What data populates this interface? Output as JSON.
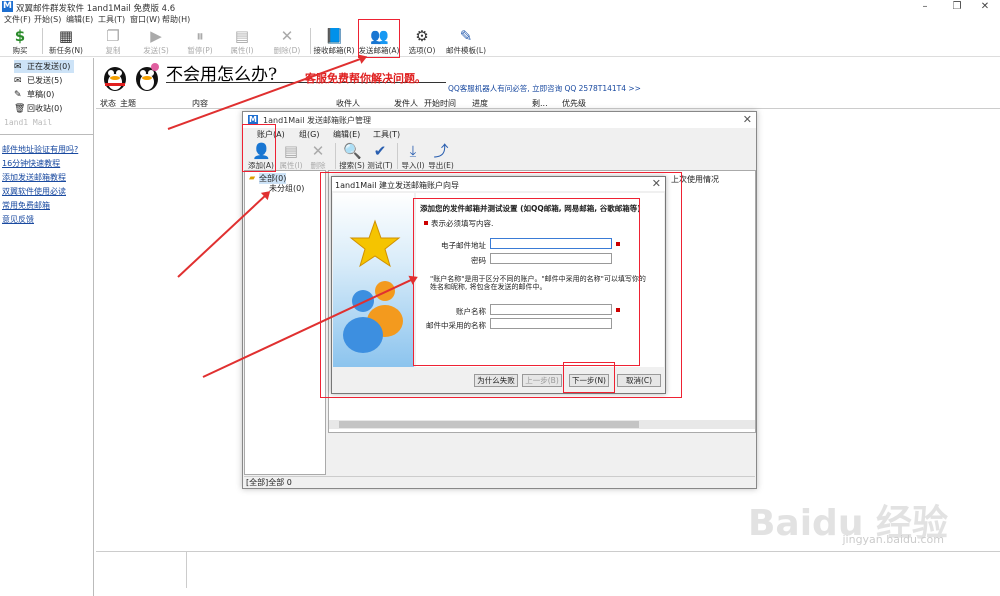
{
  "window": {
    "title": "双翼邮件群发软件 1and1Mail 免费版 4.6",
    "logo_text": "M",
    "controls": {
      "minimize": "–",
      "maximize": "❐",
      "close": "✕"
    }
  },
  "menu": [
    "文件(F)",
    "开始(S)",
    "编辑(E)",
    "工具(T)",
    "窗口(W)",
    "帮助(H)"
  ],
  "toolbar": [
    {
      "label": "购买",
      "icon": "dollar-icon",
      "glyph": "$",
      "enabled": true
    },
    {
      "label": "新任务(N)",
      "icon": "new-task-icon",
      "glyph": "▦",
      "enabled": true
    },
    {
      "label": "复制",
      "icon": "copy-icon",
      "glyph": "❐",
      "enabled": false
    },
    {
      "label": "发送(S)",
      "icon": "send-icon",
      "glyph": "▶",
      "enabled": false
    },
    {
      "label": "暂停(P)",
      "icon": "pause-icon",
      "glyph": "⏸",
      "enabled": false
    },
    {
      "label": "属性(I)",
      "icon": "properties-icon",
      "glyph": "▤",
      "enabled": false
    },
    {
      "label": "删除(D)",
      "icon": "delete-icon",
      "glyph": "✕",
      "enabled": false
    },
    {
      "label": "接收邮箱(R)",
      "icon": "receive-mailbox-icon",
      "glyph": "📘",
      "enabled": true
    },
    {
      "label": "发送邮箱(A)",
      "icon": "send-mailbox-icon",
      "glyph": "👥",
      "enabled": true
    },
    {
      "label": "选项(O)",
      "icon": "options-icon",
      "glyph": "⚙",
      "enabled": true
    },
    {
      "label": "邮件模板(L)",
      "icon": "template-icon",
      "glyph": "✎",
      "enabled": true
    }
  ],
  "folders": [
    {
      "label": "正在发送(0)",
      "icon": "sending-icon",
      "glyph": "✉",
      "selected": true
    },
    {
      "label": "已发送(5)",
      "icon": "sent-icon",
      "glyph": "✉",
      "selected": false
    },
    {
      "label": "草稿(0)",
      "icon": "drafts-icon",
      "glyph": "✎",
      "selected": false
    },
    {
      "label": "回收站(0)",
      "icon": "trash-icon",
      "glyph": "🗑",
      "selected": false
    }
  ],
  "sidebar_brand": "1and1 Mail",
  "links": [
    "邮件地址验证有用吗?",
    "16分钟快速教程",
    "添加发送邮箱教程",
    "双翼软件使用必读",
    "常用免费邮箱",
    "意见反馈"
  ],
  "banner": {
    "heading": "不会用怎么办?",
    "subheading": "客服免费帮你解决问题。",
    "qq_line": "QQ客服机器人有问必答, 立即咨询 QQ 2578T141T4 >>"
  },
  "columns": [
    "状态",
    "主题",
    "内容",
    "收件人",
    "发件人",
    "开始时间",
    "进度",
    "剩...",
    "优先级"
  ],
  "account_dialog": {
    "title": "1and1Mail 发送邮箱账户管理",
    "close": "✕",
    "menu": [
      "账户(A)",
      "组(G)",
      "编辑(E)",
      "工具(T)"
    ],
    "toolbar": [
      {
        "label": "添加(A)",
        "icon": "add-account-icon",
        "glyph": "👤",
        "enabled": true
      },
      {
        "label": "属性(I)",
        "icon": "properties-icon",
        "glyph": "▤",
        "enabled": false
      },
      {
        "label": "删除",
        "icon": "delete-icon",
        "glyph": "✕",
        "enabled": false
      },
      {
        "label": "搜索(S)",
        "icon": "search-icon",
        "glyph": "🔍",
        "enabled": true
      },
      {
        "label": "测试(T)",
        "icon": "test-icon",
        "glyph": "✔",
        "enabled": true
      },
      {
        "label": "导入(I)",
        "icon": "import-icon",
        "glyph": "⤓",
        "enabled": true
      },
      {
        "label": "导出(E)",
        "icon": "export-icon",
        "glyph": "⤴",
        "enabled": true
      }
    ],
    "tree": [
      "全部(0)",
      "未分组(0)"
    ],
    "list_header": "上次使用情况",
    "status": "[全部]全部 0"
  },
  "wizard": {
    "title": "1and1Mail 建立发送邮箱账户向导",
    "close": "✕",
    "heading": "添加您的发件邮箱并测试设置 (如QQ邮箱, 网易邮箱, 谷歌邮箱等)",
    "required_note": "表示必须填写内容.",
    "email_label": "电子邮件地址",
    "password_label": "密码",
    "description": "\"账户名称\"是用于区分不同的账户。\"邮件中采用的名称\"可以填写你的姓名和昵称, 将包含在发送的邮件中。",
    "account_name_label": "账户名称",
    "display_name_label": "邮件中采用的名称",
    "email_value": "",
    "password_value": "",
    "account_name_value": "",
    "display_name_value": "",
    "buttons": {
      "why_fail": "为什么失败",
      "prev": "上一步(B)",
      "next": "下一步(N)",
      "cancel": "取消(C)"
    }
  },
  "watermark": {
    "main": "Baidu 经验",
    "sub": "jingyan.baidu.com"
  },
  "colors": {
    "accent_red": "#e03030",
    "link_blue": "#1a4aa0",
    "selection": "#cde3f7"
  }
}
